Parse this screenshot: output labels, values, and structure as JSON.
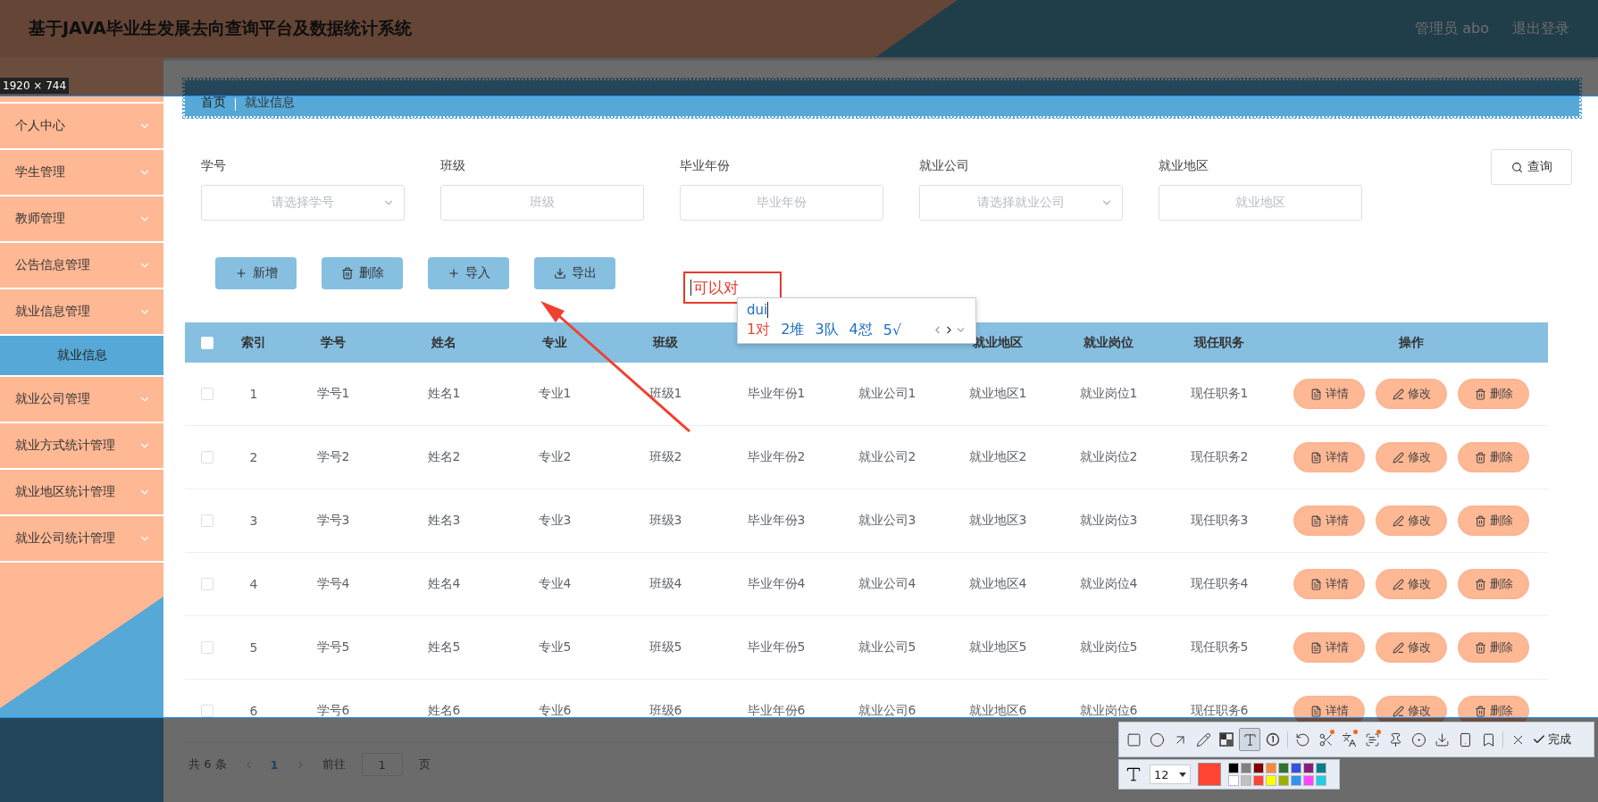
{
  "header": {
    "title": "基于JAVA毕业生发展去向查询平台及数据统计系统",
    "user": "管理员 abo",
    "logout": "退出登录"
  },
  "sidebar": {
    "items": [
      {
        "label": "个人中心",
        "selected": false
      },
      {
        "label": "学生管理",
        "selected": false
      },
      {
        "label": "教师管理",
        "selected": false
      },
      {
        "label": "公告信息管理",
        "selected": false
      },
      {
        "label": "就业信息管理",
        "selected": false,
        "children": [
          {
            "label": "就业信息",
            "selected": true
          }
        ]
      },
      {
        "label": "就业公司管理",
        "selected": false
      },
      {
        "label": "就业方式统计管理",
        "selected": false
      },
      {
        "label": "就业地区统计管理",
        "selected": false
      },
      {
        "label": "就业公司统计管理",
        "selected": false
      }
    ]
  },
  "breadcrumb": [
    "首页",
    "就业信息"
  ],
  "search": {
    "fields": [
      {
        "label": "学号",
        "placeholder": "请选择学号",
        "kind": "select"
      },
      {
        "label": "班级",
        "placeholder": "班级",
        "kind": "input"
      },
      {
        "label": "毕业年份",
        "placeholder": "毕业年份",
        "kind": "input"
      },
      {
        "label": "就业公司",
        "placeholder": "请选择就业公司",
        "kind": "select"
      },
      {
        "label": "就业地区",
        "placeholder": "就业地区",
        "kind": "input"
      }
    ],
    "button": "查询"
  },
  "actions": [
    {
      "label": "新增",
      "kind": "add"
    },
    {
      "label": "删除",
      "kind": "delete"
    },
    {
      "label": "导入",
      "kind": "add"
    },
    {
      "label": "导出",
      "kind": "export"
    }
  ],
  "table": {
    "select_all": {
      "checked": false
    },
    "columns": [
      {
        "label": "索引"
      },
      {
        "label": "学号"
      },
      {
        "label": "姓名"
      },
      {
        "label": "专业"
      },
      {
        "label": "班级"
      },
      {},
      {},
      {
        "label": "就业地区"
      },
      {
        "label": "就业岗位"
      },
      {
        "label": "现任职务"
      },
      {
        "label": "操作"
      }
    ],
    "rows": [
      {
        "checked": false,
        "cells": [
          "1",
          "学号1",
          "姓名1",
          "专业1",
          "班级1",
          "毕业年份1",
          "就业公司1",
          "就业地区1",
          "就业岗位1",
          "现任职务1"
        ],
        "actions": [
          "详情",
          "修改",
          "删除"
        ]
      },
      {
        "checked": false,
        "cells": [
          "2",
          "学号2",
          "姓名2",
          "专业2",
          "班级2",
          "毕业年份2",
          "就业公司2",
          "就业地区2",
          "就业岗位2",
          "现任职务2"
        ],
        "actions": [
          "详情",
          "修改",
          "删除"
        ]
      },
      {
        "checked": false,
        "cells": [
          "3",
          "学号3",
          "姓名3",
          "专业3",
          "班级3",
          "毕业年份3",
          "就业公司3",
          "就业地区3",
          "就业岗位3",
          "现任职务3"
        ],
        "actions": [
          "详情",
          "修改",
          "删除"
        ]
      },
      {
        "checked": false,
        "cells": [
          "4",
          "学号4",
          "姓名4",
          "专业4",
          "班级4",
          "毕业年份4",
          "就业公司4",
          "就业地区4",
          "就业岗位4",
          "现任职务4"
        ],
        "actions": [
          "详情",
          "修改",
          "删除"
        ]
      },
      {
        "checked": false,
        "cells": [
          "5",
          "学号5",
          "姓名5",
          "专业5",
          "班级5",
          "毕业年份5",
          "就业公司5",
          "就业地区5",
          "就业岗位5",
          "现任职务5"
        ],
        "actions": [
          "详情",
          "修改",
          "删除"
        ]
      },
      {
        "checked": false,
        "cells": [
          "6",
          "学号6",
          "姓名6",
          "专业6",
          "班级6",
          "毕业年份6",
          "就业公司6",
          "就业地区6",
          "就业岗位6",
          "现任职务6"
        ],
        "actions": [
          "详情",
          "修改",
          "删除"
        ]
      }
    ]
  },
  "pagination": {
    "total": "共 6 条",
    "pages": [
      {
        "label": "1",
        "selected": true
      }
    ],
    "goto": "前往",
    "page_value": "1",
    "page_unit": "页"
  },
  "capture": {
    "size": "1920 × 744",
    "annotation": "可以对",
    "ime": {
      "input": "dui",
      "candidates": [
        {
          "index": "1",
          "text": "对",
          "selected": true
        },
        {
          "index": "2",
          "text": "堆",
          "selected": false
        },
        {
          "index": "3",
          "text": "队",
          "selected": false
        },
        {
          "index": "4",
          "text": "怼",
          "selected": false
        },
        {
          "index": "5",
          "text": "√",
          "selected": false
        }
      ]
    },
    "tools": [
      {
        "kind": "rect",
        "selected": false,
        "dot": false
      },
      {
        "kind": "ellipse",
        "selected": false,
        "dot": false
      },
      {
        "kind": "arrow",
        "selected": false,
        "dot": false
      },
      {
        "kind": "pen",
        "selected": false,
        "dot": false
      },
      {
        "kind": "mosaic",
        "selected": false,
        "dot": false
      },
      {
        "kind": "text",
        "selected": true,
        "dot": false
      },
      {
        "kind": "number",
        "selected": false,
        "dot": false
      },
      {
        "kind": "undo",
        "selected": false,
        "dot": false
      },
      {
        "kind": "cut",
        "selected": false,
        "dot": true
      },
      {
        "kind": "translate",
        "selected": false,
        "dot": true
      },
      {
        "kind": "scan",
        "selected": false,
        "dot": true
      },
      {
        "kind": "pin",
        "selected": false,
        "dot": false
      },
      {
        "kind": "record",
        "selected": false,
        "dot": false
      },
      {
        "kind": "save",
        "selected": false,
        "dot": false
      },
      {
        "kind": "phone",
        "selected": false,
        "dot": false
      },
      {
        "kind": "bookmark",
        "selected": false,
        "dot": false
      },
      {
        "kind": "cancel",
        "selected": false,
        "dot": false
      }
    ],
    "done": "完成",
    "font_size": "12",
    "current_color": {
      "color": "#ff4433"
    },
    "palette": [
      {
        "color": "#000000"
      },
      {
        "color": "#808080"
      },
      {
        "color": "#800000"
      },
      {
        "color": "#f7883a"
      },
      {
        "color": "#2e7430"
      },
      {
        "color": "#3155dc"
      },
      {
        "color": "#871f78"
      },
      {
        "color": "#00808c"
      },
      {
        "color": "#ffffff"
      },
      {
        "color": "#c0c0c0"
      },
      {
        "color": "#ff4433"
      },
      {
        "color": "#ffff00"
      },
      {
        "color": "#99b000"
      },
      {
        "color": "#3093f0"
      },
      {
        "color": "#ff44ff"
      },
      {
        "color": "#1ecee6"
      }
    ]
  }
}
